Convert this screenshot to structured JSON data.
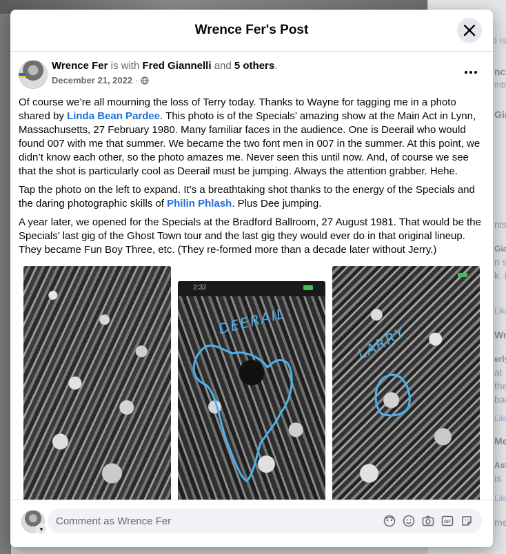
{
  "modal": {
    "title": "Wrence Fer's Post",
    "close_label": "Close"
  },
  "post": {
    "author": "Wrence Fer",
    "is_with_text": "is with",
    "tagged_person": "Fred Giannelli",
    "and_text": "and",
    "others_text": "5 others",
    "period": ".",
    "date": "December 21, 2022",
    "separator": "·",
    "paragraphs": {
      "p1_a": "Of course we’re all mourning the loss of Terry today. Thanks to Wayne for tagging me in a photo shared by ",
      "p1_link": "Linda Bean Pardee",
      "p1_b": ". This photo is of the Specials’ amazing show at the Main Act in Lynn, Massachusetts, 27 February 1980. Many familiar faces in the audience. One is Deerail who would found 007 with me that summer. We became the two font men in 007 in the summer. At this point, we didn’t know each other, so the photo amazes me. Never seen this until now. And, of course we see that the shot is particularly cool as Deerail must be jumping. Always the attention grabber. Hehe.",
      "p2_a": "Tap the photo on the left to expand. It’s a breathtaking shot thanks to the energy of the Specials and the daring photographic skills of ",
      "p2_link": "Philin Phlash",
      "p2_b": ". Plus Dee jumping.",
      "p3": "A year later, we opened for the Specials at the Bradford Ballroom, 27 August 1981. That would be the Specials’ last gig of the Ghost Town tour and the last gig they would ever do in that original lineup. They became Fun Boy Three, etc. (They re-formed more than a decade later without Jerry.)"
    },
    "photos": {
      "label_deerail": "DEERAIL",
      "label_larry": "LARRY",
      "phone_time": "2:32"
    }
  },
  "comment": {
    "placeholder": "Comment as Wrence Fer",
    "icons": [
      "avatar-sticker-icon",
      "emoji-icon",
      "camera-icon",
      "gif-icon",
      "sticker-icon"
    ]
  },
  "background": {
    "fragments": [
      "o is",
      "nce",
      "mbe",
      "Gia",
      "nts",
      "Gia",
      "n sc",
      "k. I",
      "Like",
      "Wre",
      "erly",
      "at",
      "the",
      "bac",
      "Like",
      "Me",
      "Ast",
      "is",
      "Like",
      "me"
    ]
  },
  "colors": {
    "link": "#216fdb",
    "annotation": "#47b4f0",
    "ukraine_blue": "#1e6bd6",
    "ukraine_yellow": "#f7d51d"
  }
}
